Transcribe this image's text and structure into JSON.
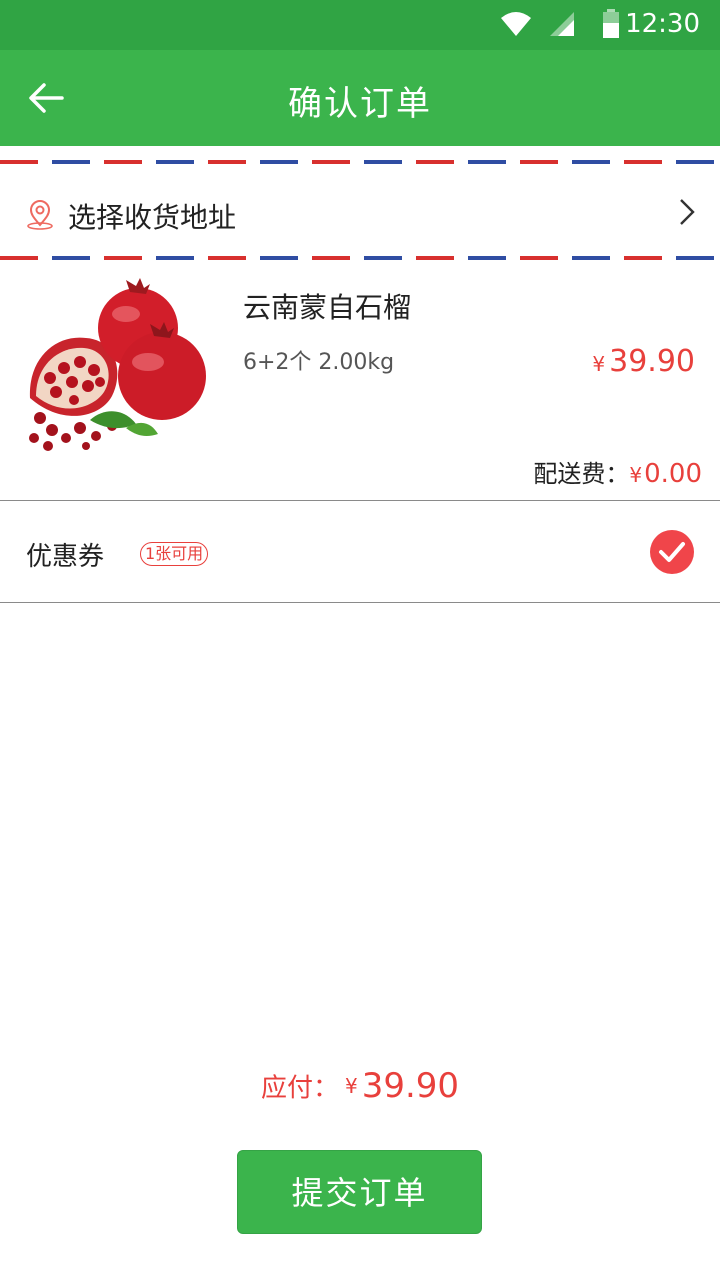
{
  "status_bar": {
    "time": "12:30"
  },
  "header": {
    "title": "确认订单"
  },
  "address": {
    "label": "选择收货地址"
  },
  "product": {
    "name": "云南蒙自石榴",
    "spec": "6+2个  2.00kg",
    "currency": "¥",
    "price": "39.90"
  },
  "delivery": {
    "label": "配送费：",
    "currency": "¥",
    "value": "0.00"
  },
  "coupon": {
    "label": "优惠券",
    "badge": "1张可用"
  },
  "total": {
    "label": "应付：",
    "currency": "¥",
    "amount": "39.90"
  },
  "submit": {
    "label": "提交订单"
  },
  "colors": {
    "status_bar": "#30a444",
    "header": "#3bb44c",
    "accent_red": "#e8403c",
    "button": "#3bb44c"
  }
}
